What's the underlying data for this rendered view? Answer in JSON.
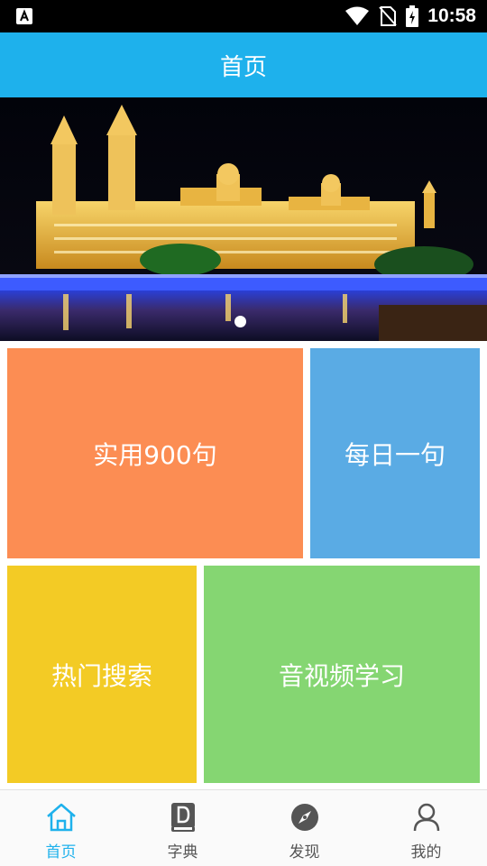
{
  "status_bar": {
    "time": "10:58",
    "icons": [
      "a11y-icon",
      "wifi-icon",
      "no-sim-icon",
      "battery-icon"
    ]
  },
  "app_bar": {
    "title": "首页"
  },
  "banner": {
    "image": "night-palace-photo",
    "slide_count": 1,
    "active_slide": 1
  },
  "tiles": [
    {
      "label": "实用900句",
      "color": "#fc8d53"
    },
    {
      "label": "每日一句",
      "color": "#5aabe4"
    },
    {
      "label": "热门搜索",
      "color": "#f3cb25"
    },
    {
      "label": "音视频学习",
      "color": "#85d672"
    }
  ],
  "bottom_nav": {
    "active_color": "#1eb1ec",
    "items": [
      {
        "label": "首页",
        "icon": "home-icon",
        "active": true
      },
      {
        "label": "字典",
        "icon": "dictionary-icon",
        "active": false
      },
      {
        "label": "发现",
        "icon": "compass-icon",
        "active": false
      },
      {
        "label": "我的",
        "icon": "person-icon",
        "active": false
      }
    ]
  }
}
